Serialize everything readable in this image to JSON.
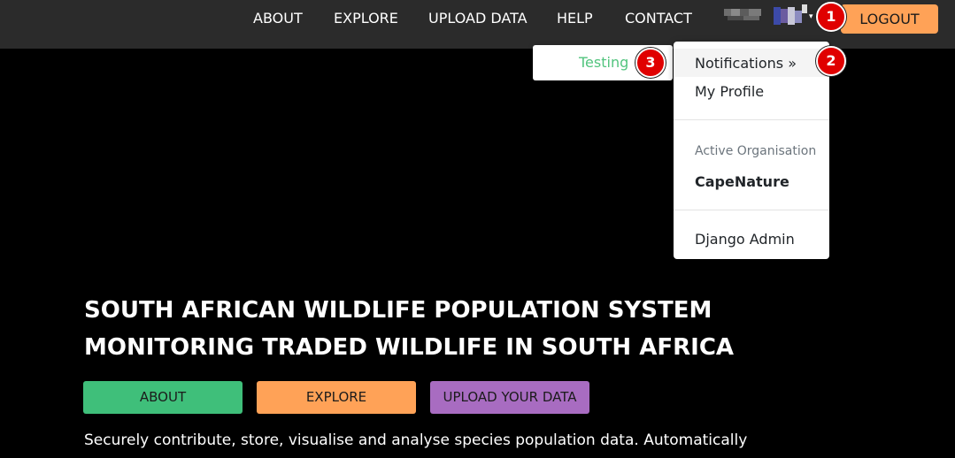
{
  "nav": {
    "links": [
      "ABOUT",
      "EXPLORE",
      "UPLOAD DATA",
      "HELP",
      "CONTACT"
    ],
    "logout_label": "LOGOUT"
  },
  "user_menu": {
    "notifications": "Notifications »",
    "profile": "My Profile",
    "org_header": "Active Organisation",
    "org_name": "CapeNature",
    "admin": "Django Admin"
  },
  "submenu": {
    "item": "Testing"
  },
  "badges": [
    "1",
    "2",
    "3"
  ],
  "hero": {
    "title_line1": "SOUTH AFRICAN WILDLIFE POPULATION SYSTEM",
    "title_line2": "MONITORING TRADED WILDLIFE IN SOUTH AFRICA",
    "buttons": [
      "ABOUT",
      "EXPLORE",
      "UPLOAD YOUR DATA"
    ],
    "description": "Securely contribute, store, visualise and analyse species population data. Automatically"
  },
  "colors": {
    "topbar": "#2b2b2b",
    "accent_orange": "#ffa257",
    "green": "#3fbf7a",
    "purple": "#a86cc1",
    "badge_red": "#e00000",
    "testing_text": "#52c47e"
  }
}
